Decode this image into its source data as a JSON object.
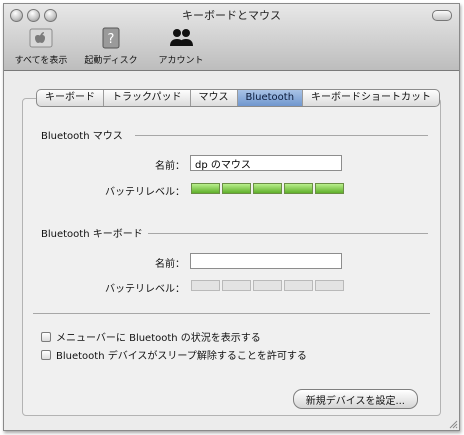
{
  "window": {
    "title": "キーボードとマウス"
  },
  "toolbar": {
    "items": [
      {
        "label": "すべてを表示",
        "icon": "apple-icon"
      },
      {
        "label": "起動ディスク",
        "icon": "disk-icon"
      },
      {
        "label": "アカウント",
        "icon": "accounts-icon"
      }
    ]
  },
  "tabs": [
    {
      "label": "キーボード"
    },
    {
      "label": "トラックパッド"
    },
    {
      "label": "マウス"
    },
    {
      "label": "Bluetooth",
      "active": true
    },
    {
      "label": "キーボードショートカット"
    }
  ],
  "mouse_section": {
    "title": "Bluetooth マウス",
    "name_label": "名前：",
    "name_value": "dp のマウス",
    "battery_label": "バッテリレベル：",
    "battery_level": 1.0
  },
  "keyboard_section": {
    "title": "Bluetooth キーボード",
    "name_label": "名前：",
    "name_value": "",
    "battery_label": "バッテリレベル：",
    "battery_level": 0
  },
  "options": {
    "show_status": "メニューバーに Bluetooth の状況を表示する",
    "allow_wake": "Bluetooth デバイスがスリープ解除することを許可する"
  },
  "setup_button": "新規デバイスを設定...",
  "colors": {
    "battery_on": "#6fbf3a",
    "tab_active": "#86a9da"
  }
}
